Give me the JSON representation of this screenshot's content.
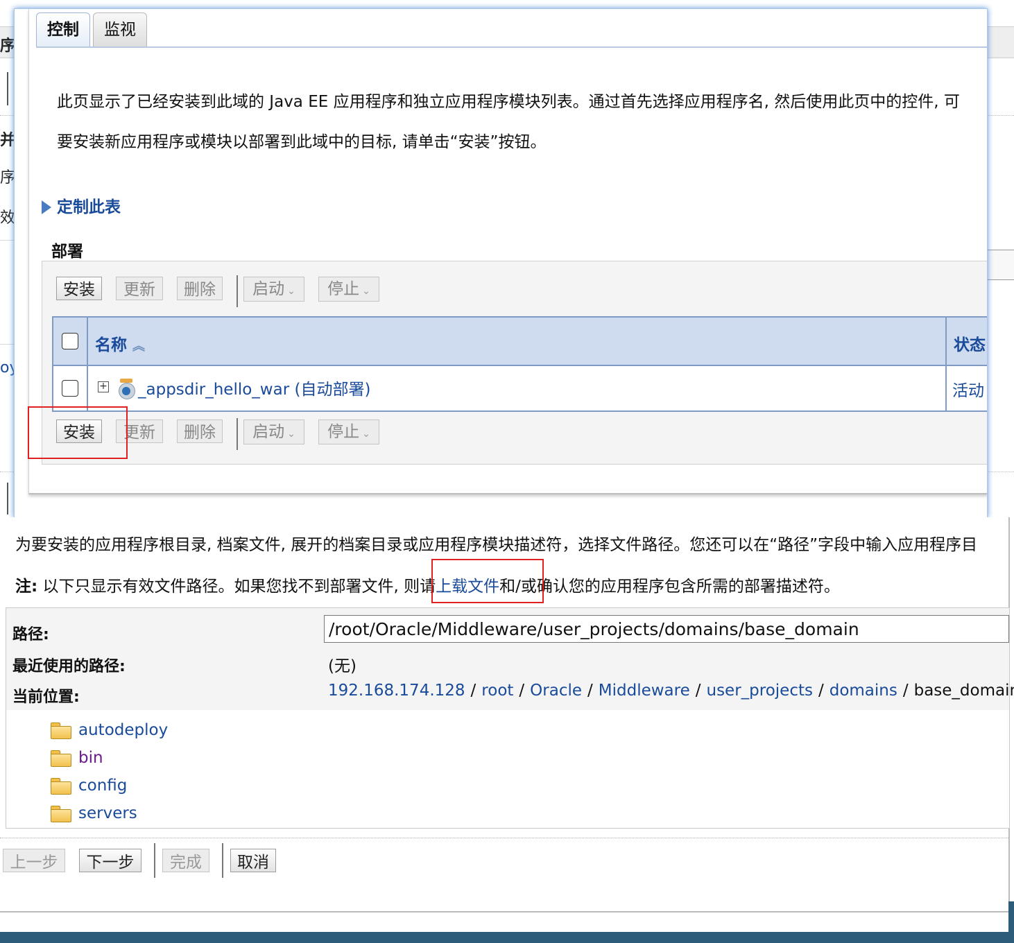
{
  "background": {
    "left_fragments": [
      "序",
      "并",
      "序",
      "效",
      "oy"
    ]
  },
  "tabs": [
    {
      "label": "控制",
      "active": true
    },
    {
      "label": "监视",
      "active": false
    }
  ],
  "intro": {
    "line1": "此页显示了已经安装到此域的 Java EE 应用程序和独立应用程序模块列表。通过首先选择应用程序名, 然后使用此页中的控件, 可",
    "line2": "要安装新应用程序或模块以部署到此域中的目标, 请单击“安装”按钮。"
  },
  "customize_link": "定制此表",
  "deployments": {
    "title": "部署",
    "buttons": {
      "install": "安装",
      "update": "更新",
      "delete": "删除",
      "start": "启动",
      "stop": "停止"
    },
    "columns": {
      "name": "名称",
      "state": "状态"
    },
    "rows": [
      {
        "name": "_appsdir_hello_war (自动部署)",
        "state": "活动"
      }
    ]
  },
  "wizard": {
    "instruction": "为要安装的应用程序根目录, 档案文件, 展开的档案目录或应用程序模块描述符，选择文件路径。您还可以在“路径”字段中输入应用程序目",
    "note_label": "注:",
    "note_before": " 以下只显示有效文件路径。如果您找不到部署文件, 则请",
    "note_link": "上载文件",
    "note_after": "和/或确认您的应用程序包含所需的部署描述符。",
    "path_label": "路径:",
    "path_value": "/root/Oracle/Middleware/user_projects/domains/base_domain",
    "recent_label": "最近使用的路径:",
    "recent_value": "(无)",
    "location_label": "当前位置:",
    "breadcrumb": [
      "192.168.174.128",
      "root",
      "Oracle",
      "Middleware",
      "user_projects",
      "domains"
    ],
    "breadcrumb_current": "base_domain",
    "breadcrumb_separator": "/",
    "folders": [
      "autodeploy",
      "bin",
      "config",
      "servers"
    ],
    "buttons": {
      "back": "上一步",
      "next": "下一步",
      "finish": "完成",
      "cancel": "取消"
    }
  },
  "colors": {
    "link": "#1a4b9a",
    "header_bg": "#cfdbee",
    "highlight": "#e02020",
    "popup_glow": "#5b93d8"
  }
}
